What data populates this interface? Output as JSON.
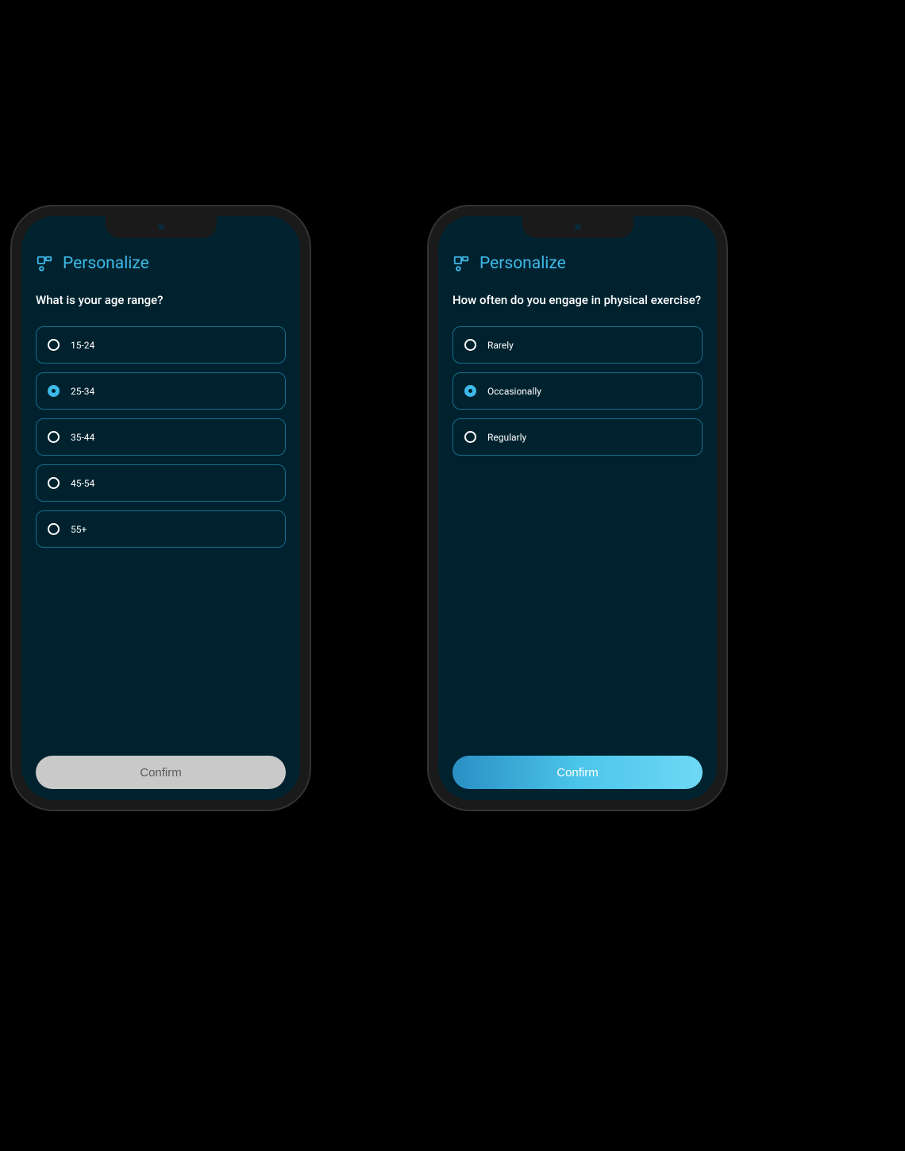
{
  "header_title": "Personalize",
  "confirm_label": "Confirm",
  "screens": [
    {
      "question": "What is your age range?",
      "selected_index": 1,
      "confirm_enabled": false,
      "options": [
        "15-24",
        "25-34",
        "35-44",
        "45-54",
        "55+"
      ]
    },
    {
      "question": "How often do you engage in physical exercise?",
      "selected_index": 1,
      "confirm_enabled": true,
      "options": [
        "Rarely",
        "Occasionally",
        "Regularly"
      ]
    }
  ],
  "colors": {
    "accent": "#3db9e8",
    "screen_bg": "#00222f",
    "option_border": "#1a6a8a",
    "confirm_disabled_bg": "#c9c9c9",
    "confirm_enabled_gradient": [
      "#2a8fc4",
      "#4bc5ea",
      "#6fd8f5"
    ]
  }
}
